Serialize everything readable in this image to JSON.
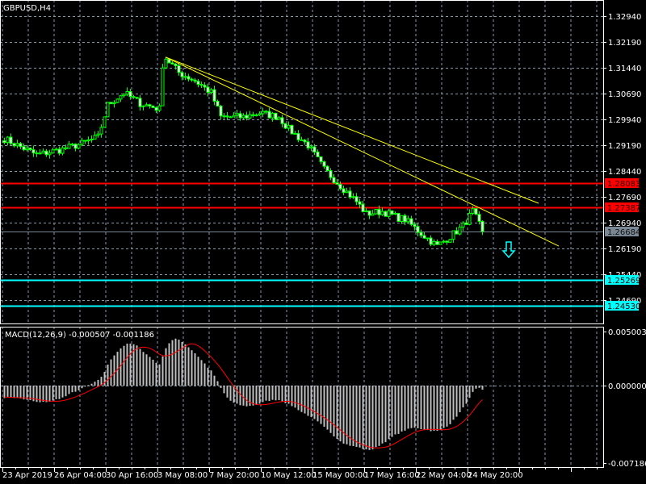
{
  "window": {
    "title": "GBPUSD,H4"
  },
  "colors": {
    "background": "#000000",
    "grid": "#8a99aa",
    "candle_outline": "#00ff00",
    "bear_fill": "#ffffff",
    "bull_fill": "#000000",
    "trendline": "#ffff00",
    "resistance": "#ff0000",
    "support": "#00ffff",
    "current_price": "#7a8794",
    "macd_hist": "#c0c0c0",
    "macd_signal": "#ff0000"
  },
  "price_axis": {
    "labels": [
      "1.32940",
      "1.32190",
      "1.31440",
      "1.30690",
      "1.29940",
      "1.29190",
      "1.28440",
      "1.27690",
      "1.26940",
      "1.26190",
      "1.25440",
      "1.24690"
    ]
  },
  "time_axis": {
    "labels": [
      "23 Apr 2019",
      "26 Apr 04:00",
      "30 Apr 16:00",
      "3 May 08:00",
      "7 May 20:00",
      "10 May 12:00",
      "15 May 00:00",
      "17 May 16:00",
      "22 May 04:00",
      "24 May 20:00"
    ],
    "bars_per_label": 16
  },
  "horizontal_lines": [
    {
      "name": "resistance-line-1",
      "price": "1.28083",
      "color": "#ff0000"
    },
    {
      "name": "resistance-line-2",
      "price": "1.27387",
      "color": "#ff0000"
    },
    {
      "name": "current-price-line",
      "price": "1.26684",
      "color": "#7a8794"
    },
    {
      "name": "support-line-1",
      "price": "1.25269",
      "color": "#00ffff"
    },
    {
      "name": "support-line-2",
      "price": "1.24530",
      "color": "#00ffff"
    }
  ],
  "macd": {
    "label": "MACD(12,26,9) -0.000507 -0.001186",
    "axis_top": "0.005003",
    "axis_zero": "0.000000",
    "axis_bottom": "-0.007186",
    "fast": 12,
    "slow": 26,
    "signal": 9
  },
  "chart_data": {
    "type": "candlestick",
    "symbol": "GBPUSD",
    "timeframe": "H4",
    "bar_count": 149,
    "ylim": [
      1.2403,
      1.33409
    ],
    "close_keypoints": [
      [
        0,
        1.29378
      ],
      [
        10,
        1.28909
      ],
      [
        18,
        1.29073
      ],
      [
        24,
        1.29237
      ],
      [
        29,
        1.29425
      ],
      [
        32,
        1.30362
      ],
      [
        37,
        1.30714
      ],
      [
        42,
        1.30409
      ],
      [
        48,
        1.30245
      ],
      [
        49,
        1.31534
      ],
      [
        50,
        1.31721
      ],
      [
        54,
        1.313
      ],
      [
        59,
        1.31065
      ],
      [
        64,
        1.30714
      ],
      [
        67,
        1.30011
      ],
      [
        74,
        1.30011
      ],
      [
        79,
        1.30128
      ],
      [
        85,
        1.30011
      ],
      [
        88,
        1.29659
      ],
      [
        94,
        1.2919
      ],
      [
        99,
        1.28487
      ],
      [
        104,
        1.28018
      ],
      [
        109,
        1.2755
      ],
      [
        112,
        1.27198
      ],
      [
        117,
        1.27268
      ],
      [
        122,
        1.27081
      ],
      [
        124,
        1.27034
      ],
      [
        129,
        1.26627
      ],
      [
        134,
        1.2626
      ],
      [
        139,
        1.26613
      ],
      [
        142,
        1.26847
      ],
      [
        145,
        1.27268
      ],
      [
        148,
        1.26684
      ]
    ],
    "trendlines": [
      {
        "from": [
          50,
          1.3175
        ],
        "to": [
          165.5,
          1.27503
        ]
      },
      {
        "from": [
          50,
          1.3175
        ],
        "to": [
          171.75,
          1.2626
        ]
      }
    ],
    "sell_arrow": {
      "bar": 156.5,
      "price": 1.26378
    }
  }
}
